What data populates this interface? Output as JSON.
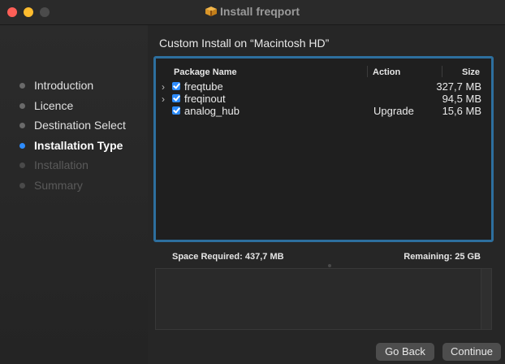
{
  "window": {
    "title": "Install freqport",
    "title_icon": "package-icon"
  },
  "sidebar": {
    "steps": [
      {
        "label": "Introduction",
        "state": "done"
      },
      {
        "label": "Licence",
        "state": "done"
      },
      {
        "label": "Destination Select",
        "state": "done"
      },
      {
        "label": "Installation Type",
        "state": "active"
      },
      {
        "label": "Installation",
        "state": "future"
      },
      {
        "label": "Summary",
        "state": "future"
      }
    ]
  },
  "main": {
    "heading": "Custom Install on “Macintosh HD”",
    "table": {
      "columns": {
        "name": "Package Name",
        "action": "Action",
        "size": "Size"
      },
      "rows": [
        {
          "name": "freqtube",
          "action": "",
          "size": "327,7 MB",
          "expandable": true,
          "checked": true
        },
        {
          "name": "freqinout",
          "action": "",
          "size": "94,5 MB",
          "expandable": true,
          "checked": true
        },
        {
          "name": "analog_hub",
          "action": "Upgrade",
          "size": "15,6 MB",
          "expandable": false,
          "checked": true
        }
      ]
    },
    "space_required": "Space Required:  437,7 MB",
    "remaining": "Remaining:  25 GB"
  },
  "footer": {
    "back_label": "Go Back",
    "continue_label": "Continue"
  },
  "colors": {
    "accent": "#2d8cff",
    "focus_ring": "#2d6f9e"
  }
}
